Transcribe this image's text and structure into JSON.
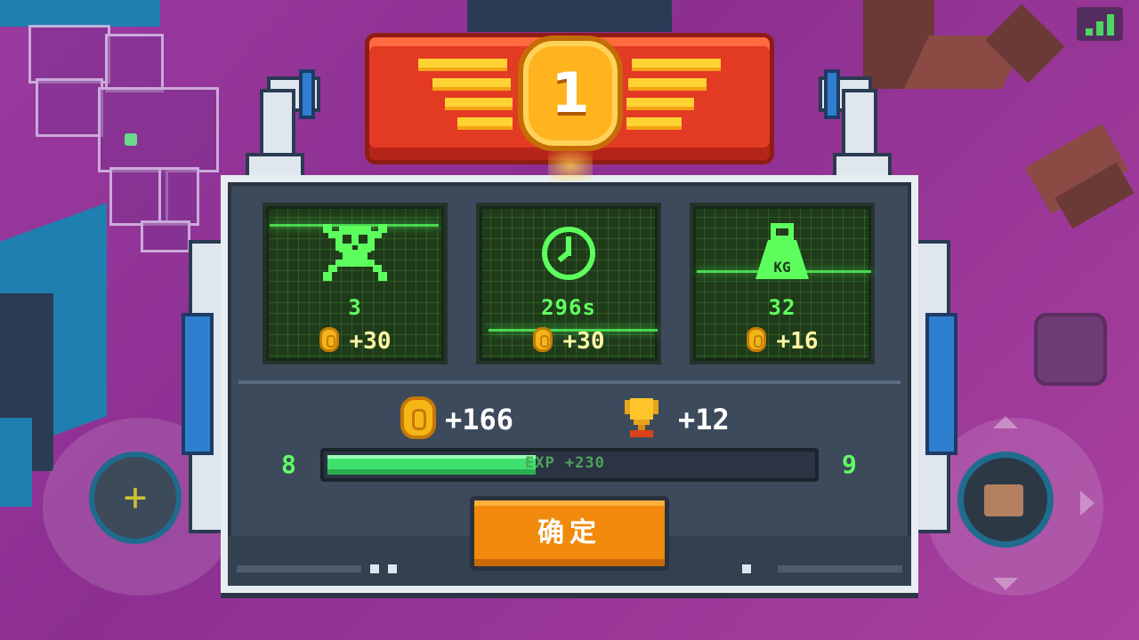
{
  "rank": {
    "number": "1"
  },
  "stats": [
    {
      "icon": "skull-crossbones-icon",
      "value": "3",
      "reward": "+30"
    },
    {
      "icon": "clock-icon",
      "value": "296s",
      "reward": "+30"
    },
    {
      "icon": "kg-weight-icon",
      "value": "32",
      "reward": "+16",
      "icon_text": "KG"
    }
  ],
  "totals": {
    "coins": "+166",
    "trophies": "+12"
  },
  "level": {
    "current": "8",
    "next": "9",
    "exp_text": "EXP +230",
    "progress_fraction": 0.43
  },
  "confirm_button": {
    "label": "确定"
  },
  "colors": {
    "accent_green": "#62ff62",
    "coin_gold": "#f5b716",
    "button_orange": "#f18a0c",
    "banner_red": "#e33a24",
    "panel": "#3c4a5c"
  }
}
